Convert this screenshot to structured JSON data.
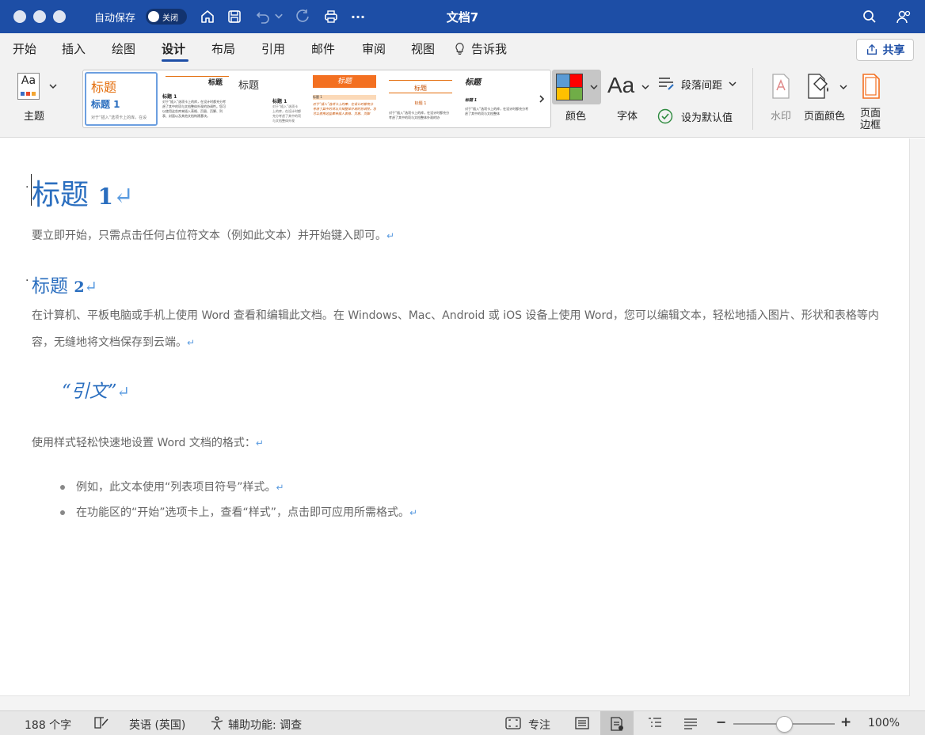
{
  "titlebar": {
    "autosave_label": "自动保存",
    "toggle_label": "关闭",
    "document_title": "文档7",
    "more_label": "···"
  },
  "tabs": [
    {
      "label": "开始"
    },
    {
      "label": "插入"
    },
    {
      "label": "绘图"
    },
    {
      "label": "设计",
      "active": true
    },
    {
      "label": "布局"
    },
    {
      "label": "引用"
    },
    {
      "label": "邮件"
    },
    {
      "label": "审阅"
    },
    {
      "label": "视图"
    },
    {
      "label": "告诉我"
    }
  ],
  "share_label": "共享",
  "ribbon": {
    "theme_label": "主题",
    "theme_icon_text": "Aa",
    "gallery": {
      "thumb1": {
        "title": "标题",
        "heading": "标题 1",
        "body": "对于“插入”选项卡上的库，在设"
      },
      "thumb2": {
        "title": "标题",
        "heading": "标题 1",
        "body": "对于“插入”选项卡上的库，在设计时都充分考虑了其中的项与文档整体外观的协调性。您可以使用这些库来插入表格、页眉、页脚、列表、封面以及其他文档构建基块。"
      },
      "thumb3": {
        "title": "标题",
        "heading": "标题 1",
        "body": "对于“插入”选项卡上的库，在设计时都充分考虑了其中的项与文档整体外观"
      },
      "thumb4": {
        "title": "标题",
        "heading": "标题 1",
        "body": "对于“插入”选项卡上的库，在设计时都充分考虑了其中的项与文档整体外观的协调性。您可以使用这些库来插入表格、页眉、页脚"
      },
      "thumb5": {
        "title": "标题",
        "heading": "标题 1",
        "body": "对于“插入”选项卡上的库，在设计时都充分考虑了其中的项与文档整体外观的协"
      },
      "thumb6": {
        "title": "标题",
        "heading": "标题 1",
        "body": "对于“插入”选项卡上的库，在设计时都充分考虑了其中的项与文档整体"
      }
    },
    "colors_label": "颜色",
    "fonts_label": "字体",
    "fonts_icon_text": "Aa",
    "paragraph_spacing_label": "段落间距",
    "set_default_label": "设为默认值",
    "watermark_label": "水印",
    "page_color_label": "页面颜色",
    "page_borders_label_1": "页面",
    "page_borders_label_2": "边框",
    "swatch_colors": [
      "#5b9bd5",
      "#ff0000",
      "#ffc000",
      "#70ad47"
    ]
  },
  "document": {
    "heading1_text": "标题 ",
    "heading1_num": "1",
    "para1": "要立即开始，只需点击任何占位符文本（例如此文本）并开始键入即可。",
    "heading2_text": "标题 ",
    "heading2_num": "2",
    "para2": "在计算机、平板电脑或手机上使用 Word 查看和编辑此文档。在 Windows、Mac、Android 或 iOS 设备上使用 Word，您可以编辑文本，轻松地插入图片、形状和表格等内容，无缝地将文档保存到云端。",
    "quote": "“引文”",
    "para3": "使用样式轻松快速地设置 Word 文档的格式：",
    "list_items": [
      "例如，此文本使用“列表项目符号”样式。",
      "在功能区的“开始”选项卡上，查看“样式”，点击即可应用所需格式。"
    ],
    "return_mark": "↵",
    "bullet_mark": "·"
  },
  "statusbar": {
    "word_count": "188 个字",
    "language": "英语 (英国)",
    "accessibility": "辅助功能: 调查",
    "focus": "专注",
    "zoom_minus": "−",
    "zoom_plus": "+",
    "zoom_level": "100%",
    "zoom_fraction": 0.5
  }
}
